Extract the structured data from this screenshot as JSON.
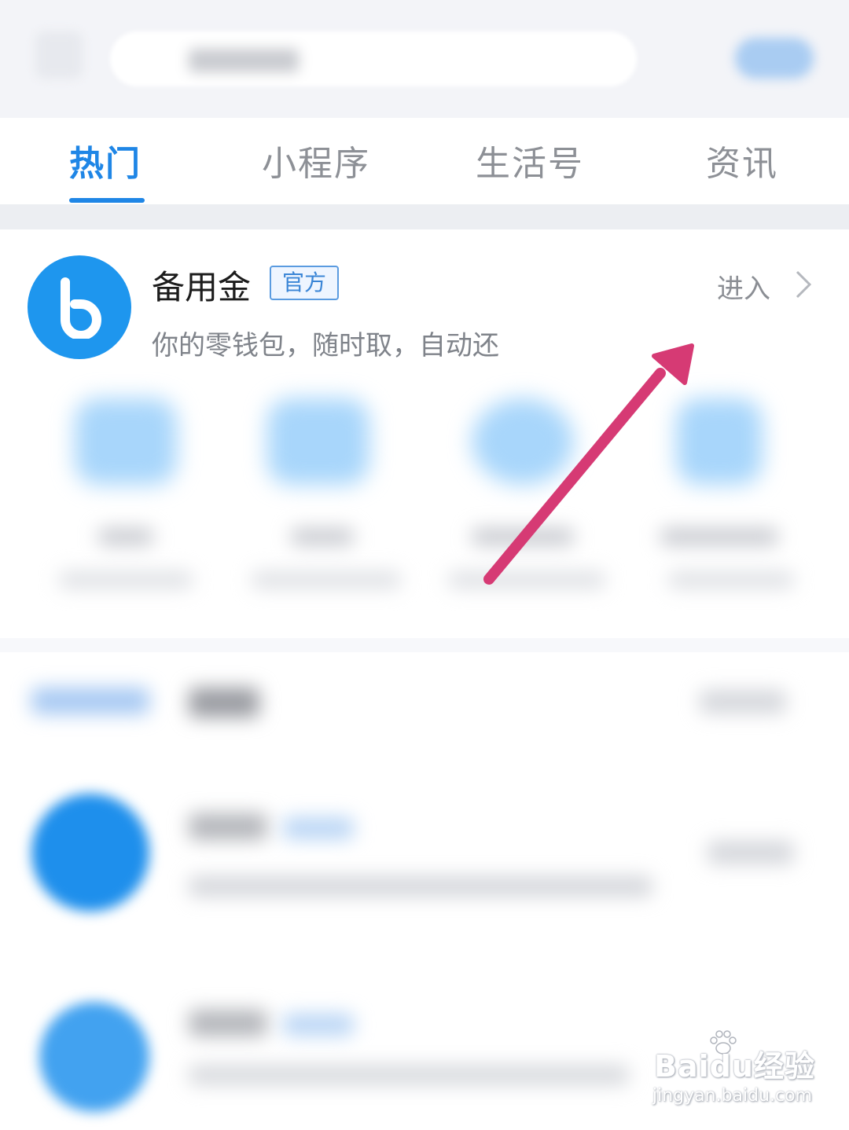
{
  "tabs": [
    {
      "label": "热门",
      "active": true
    },
    {
      "label": "小程序",
      "active": false
    },
    {
      "label": "生活号",
      "active": false
    },
    {
      "label": "资讯",
      "active": false
    }
  ],
  "result": {
    "name": "备用金",
    "badge": "官方",
    "description": "你的零钱包，随时取，自动还",
    "enter_label": "进入",
    "logo_letter": "b"
  },
  "watermark": {
    "main": "Baidu经验",
    "sub": "jingyan.baidu.com"
  },
  "colors": {
    "accent": "#1f86e6",
    "arrow": "#d63a74",
    "logo_bg": "#1e96ee"
  },
  "icons": [
    "back-icon",
    "search-icon",
    "chevron-right-icon",
    "annotation-arrow-icon",
    "paw-icon"
  ]
}
